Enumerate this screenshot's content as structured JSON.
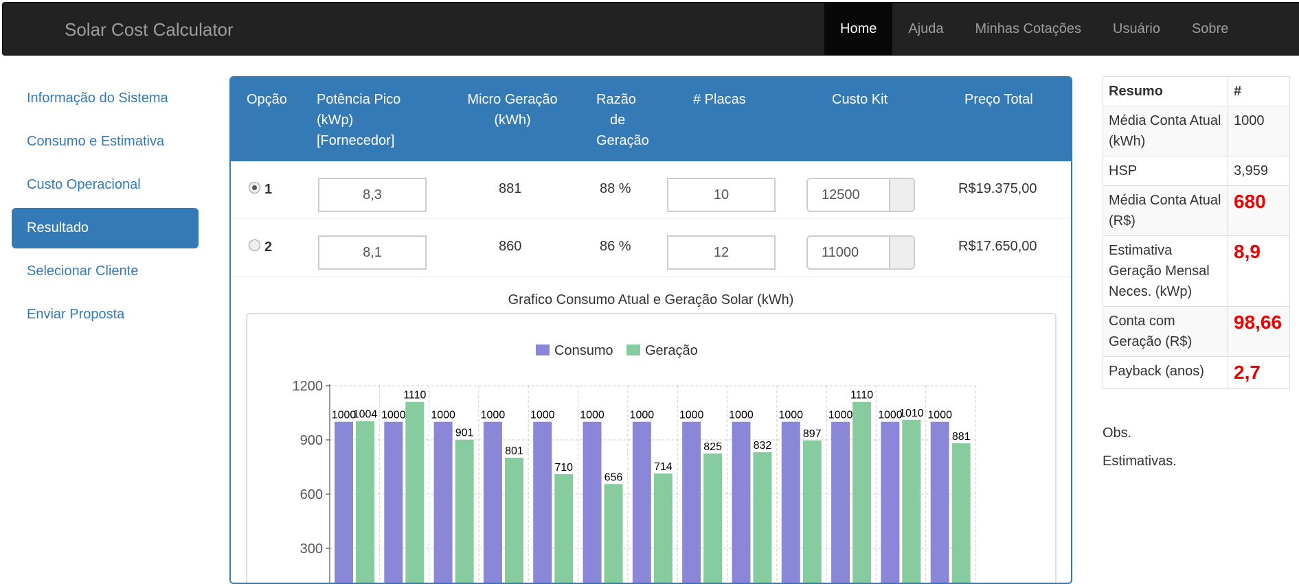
{
  "navbar": {
    "brand": "Solar Cost Calculator",
    "items": [
      {
        "label": "Home",
        "active": true
      },
      {
        "label": "Ajuda"
      },
      {
        "label": "Minhas Cotações"
      },
      {
        "label": "Usuário"
      },
      {
        "label": "Sobre"
      }
    ]
  },
  "sidebar": {
    "items": [
      {
        "label": "Informação do Sistema"
      },
      {
        "label": "Consumo e Estimativa"
      },
      {
        "label": "Custo Operacional"
      },
      {
        "label": "Resultado",
        "active": true
      },
      {
        "label": "Selecionar Cliente"
      },
      {
        "label": "Enviar Proposta"
      }
    ]
  },
  "table": {
    "headers": {
      "opcao": "Opção",
      "potencia_1": "Potência Pico",
      "potencia_2": "(kWp)",
      "potencia_3": "[Fornecedor]",
      "micro_1": "Micro Geração",
      "micro_2": "(kWh)",
      "razao_1": "Razão",
      "razao_2": "de",
      "razao_3": "Geração",
      "placas": "# Placas",
      "custo": "Custo Kit",
      "preco": "Preço Total"
    },
    "rows": [
      {
        "option": "1",
        "selected": true,
        "potencia": "8,3",
        "micro": "881",
        "razao": "88 %",
        "placas": "10",
        "custo": "12500",
        "preco": "R$19.375,00"
      },
      {
        "option": "2",
        "selected": false,
        "potencia": "8,1",
        "micro": "860",
        "razao": "86 %",
        "placas": "12",
        "custo": "11000",
        "preco": "R$17.650,00"
      }
    ]
  },
  "chart_data": {
    "type": "bar",
    "title": "Grafico Consumo Atual e Geração Solar (kWh)",
    "categories": [
      "",
      "",
      "",
      "",
      "",
      "",
      "",
      "",
      "",
      "",
      "",
      "",
      ""
    ],
    "series": [
      {
        "name": "Consumo",
        "color": "#8a87d8",
        "values": [
          1000,
          1000,
          1000,
          1000,
          1000,
          1000,
          1000,
          1000,
          1000,
          1000,
          1000,
          1000,
          1000
        ]
      },
      {
        "name": "Geração",
        "color": "#86cc9f",
        "values": [
          1004,
          1110,
          901,
          801,
          710,
          656,
          714,
          825,
          832,
          897,
          1110,
          1010,
          881
        ]
      }
    ],
    "yticks": [
      "1200",
      "900",
      "600",
      "300"
    ],
    "ylim": [
      0,
      1200
    ],
    "grid": true,
    "legend": "top-center"
  },
  "summary": {
    "header_label": "Resumo",
    "header_value": "#",
    "rows": [
      {
        "label": "Média Conta Atual (kWh)",
        "value": "1000",
        "big": false
      },
      {
        "label": "HSP",
        "value": "3,959",
        "big": false
      },
      {
        "label": "Média Conta Atual (R$)",
        "value": "680",
        "big": true
      },
      {
        "label": "Estimativa Geração Mensal Neces. (kWp)",
        "value": "8,9",
        "big": true
      },
      {
        "label": "Conta com Geração (R$)",
        "value": "98,66",
        "big": true
      },
      {
        "label": "Payback (anos)",
        "value": "2,7",
        "big": true
      }
    ],
    "obs": "Obs.",
    "estimativas": "Estimativas."
  }
}
